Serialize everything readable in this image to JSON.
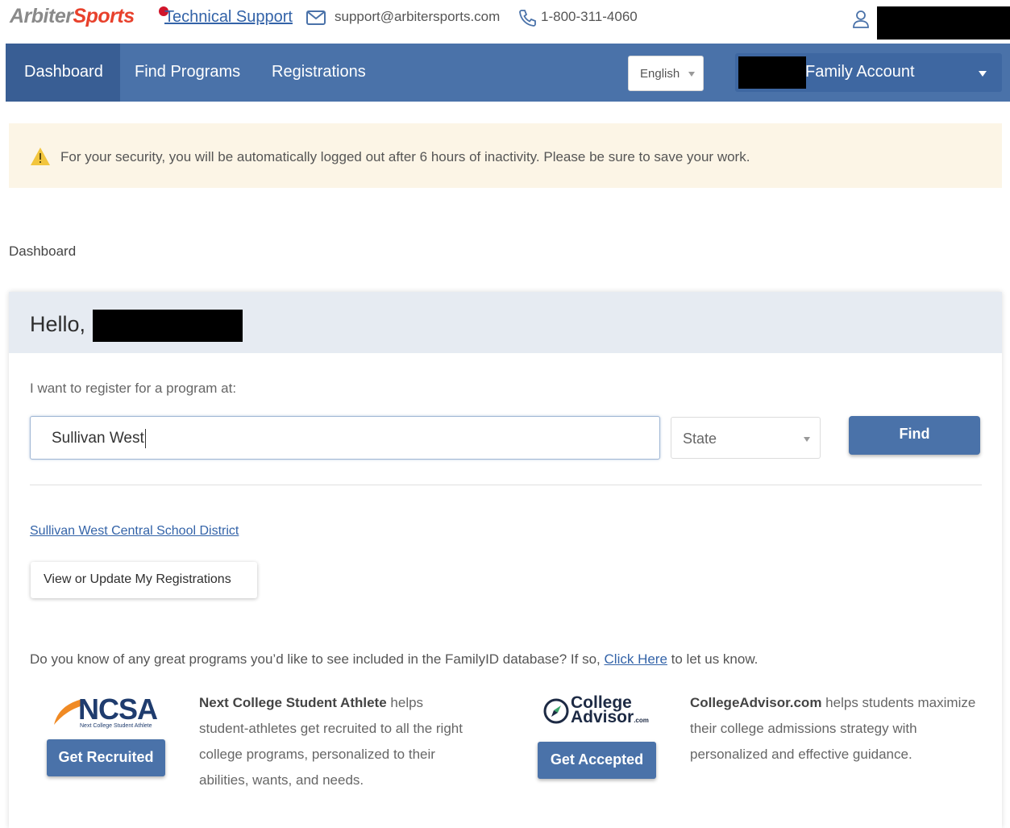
{
  "header": {
    "logo_part1": "Arbiter",
    "logo_part2": "Sports",
    "support_link": "Technical Support",
    "email": "support@arbitersports.com",
    "phone": "1-800-311-4060"
  },
  "nav": {
    "items": [
      {
        "label": "Dashboard",
        "active": true
      },
      {
        "label": "Find Programs",
        "active": false
      },
      {
        "label": "Registrations",
        "active": false
      }
    ],
    "language": "English",
    "account": "Family Account"
  },
  "alert": {
    "text": "For your security, you will be automatically logged out after 6 hours of inactivity. Please be sure to save your work."
  },
  "breadcrumb": "Dashboard",
  "card": {
    "greeting": "Hello,",
    "register_label": "I want to register for a program at:",
    "search_value": "Sullivan West",
    "state_placeholder": "State",
    "find_button": "Find",
    "result_link": "Sullivan West Central School District",
    "view_button": "View or Update My Registrations",
    "know_prefix": "Do you know of any great programs you’d like to see included in the FamilyID database? If so,",
    "know_link": "Click Here",
    "know_suffix": "to let us know."
  },
  "partners": {
    "ncsa": {
      "logo_text": "NCSA",
      "logo_sub": "Next College Student Athlete",
      "button": "Get Recruited",
      "name": "Next College Student Athlete",
      "desc": "helps student-athletes get recruited to all the right college programs, personalized to their abilities, wants, and needs."
    },
    "college_advisor": {
      "logo_line1": "College",
      "logo_line2": "Advisor",
      "logo_com": ".com",
      "button": "Get Accepted",
      "name": "CollegeAdvisor.com",
      "desc": "helps students maximize their college admissions strategy with personalized and effective guidance."
    }
  },
  "colors": {
    "nav_bg": "#4a72a9",
    "nav_active": "#395e94",
    "link": "#3363a8",
    "alert_bg": "#fcf5e6",
    "brand_red": "#e8412c"
  }
}
